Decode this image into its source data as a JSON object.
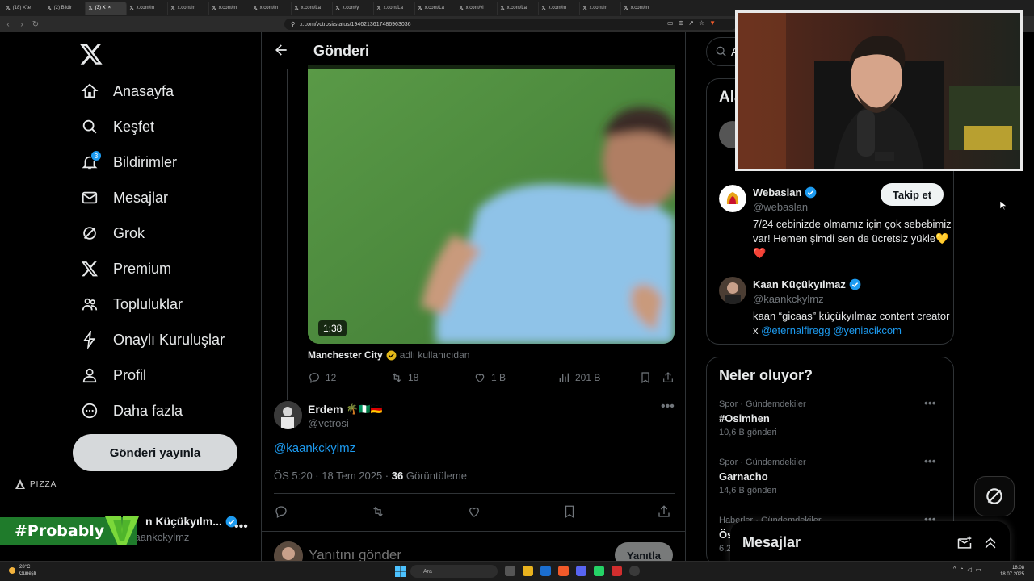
{
  "browser": {
    "tabs": [
      {
        "label": "(18) X'te",
        "active": false
      },
      {
        "label": "(2) Bildir",
        "active": false
      },
      {
        "label": "(3) X",
        "active": true
      },
      {
        "label": "x.com/m",
        "active": false
      },
      {
        "label": "x.com/m",
        "active": false
      },
      {
        "label": "x.com/m",
        "active": false
      },
      {
        "label": "x.com/m",
        "active": false
      },
      {
        "label": "x.com/La",
        "active": false
      },
      {
        "label": "x.com/y",
        "active": false
      },
      {
        "label": "x.com/La",
        "active": false
      },
      {
        "label": "x.com/La",
        "active": false
      },
      {
        "label": "x.com/yi",
        "active": false
      },
      {
        "label": "x.com/La",
        "active": false
      },
      {
        "label": "x.com/m",
        "active": false
      },
      {
        "label": "x.com/m",
        "active": false
      },
      {
        "label": "x.com/m",
        "active": false
      }
    ],
    "url": "x.com/vctrosi/status/1946213617486963036"
  },
  "nav": {
    "items": [
      {
        "label": "Anasayfa",
        "icon": "home-icon"
      },
      {
        "label": "Keşfet",
        "icon": "search-icon"
      },
      {
        "label": "Bildirimler",
        "icon": "bell-icon",
        "badge": "3"
      },
      {
        "label": "Mesajlar",
        "icon": "mail-icon"
      },
      {
        "label": "Grok",
        "icon": "grok-icon"
      },
      {
        "label": "Premium",
        "icon": "x-icon"
      },
      {
        "label": "Topluluklar",
        "icon": "people-icon"
      },
      {
        "label": "Onaylı Kuruluşlar",
        "icon": "bolt-icon"
      },
      {
        "label": "Profil",
        "icon": "person-icon"
      },
      {
        "label": "Daha fazla",
        "icon": "more-circle-icon"
      }
    ],
    "post_button": "Gönderi yayınla",
    "pizza_label": "PIZZA",
    "account": {
      "name": "n Küçükyılm...",
      "handle": "kaankckylmz"
    },
    "overlay_tag": "#Probably"
  },
  "main": {
    "header_title": "Gönderi",
    "video": {
      "duration": "1:38",
      "attribution_name": "Manchester City",
      "attribution_suffix": "adlı kullanıcıdan"
    },
    "quoted_actions": {
      "replies": "12",
      "reposts": "18",
      "likes": "1 B",
      "views": "201 B"
    },
    "reply": {
      "name": "Erdem",
      "emoji": "🌴🇳🇬🇩🇪",
      "handle": "@vctrosi",
      "mention": "@kaankckylmz",
      "timestamp": "ÖS 5:20 · 18 Tem 2025 · ",
      "views_count": "36",
      "views_label": "Görüntüleme"
    },
    "compose": {
      "placeholder": "Yanıtını gönder",
      "button": "Yanıtla"
    }
  },
  "right": {
    "search_placeholder": "A",
    "who_to_follow": {
      "title": "Ala",
      "items": [
        {
          "name": "Webaslan",
          "handle": "@webaslan",
          "bio": "7/24 cebinizde olmamız için çok sebebimiz var! Hemen şimdi sen de ücretsiz yükle💛❤️",
          "follow_label": "Takip et"
        },
        {
          "name": "Kaan Küçükyılmaz",
          "handle": "@kaankckylmz",
          "bio_prefix": "kaan “gicaas” küçükyılmaz content creator x ",
          "bio_link1": "@eternalfiregg",
          "bio_link2": "@yeniacikcom"
        }
      ]
    },
    "trends": {
      "title": "Neler oluyor?",
      "items": [
        {
          "category": "Spor · Gündemdekiler",
          "name": "#Osimhen",
          "count": "10,6 B gönderi"
        },
        {
          "category": "Spor · Gündemdekiler",
          "name": "Garnacho",
          "count": "14,6 B gönderi"
        },
        {
          "category": "Haberler · Gündemdekiler",
          "name": "Ös",
          "count": "6,2"
        }
      ]
    },
    "messages_drawer": "Mesajlar"
  },
  "taskbar": {
    "weather_temp": "28°C",
    "weather_desc": "Güneşli",
    "search_label": "Ara",
    "time": "18:08",
    "date": "18.07.2025"
  },
  "colors": {
    "accent": "#1d9bf0",
    "background": "#000000",
    "muted": "#71767b",
    "overlay_green": "#1f7b2b"
  }
}
